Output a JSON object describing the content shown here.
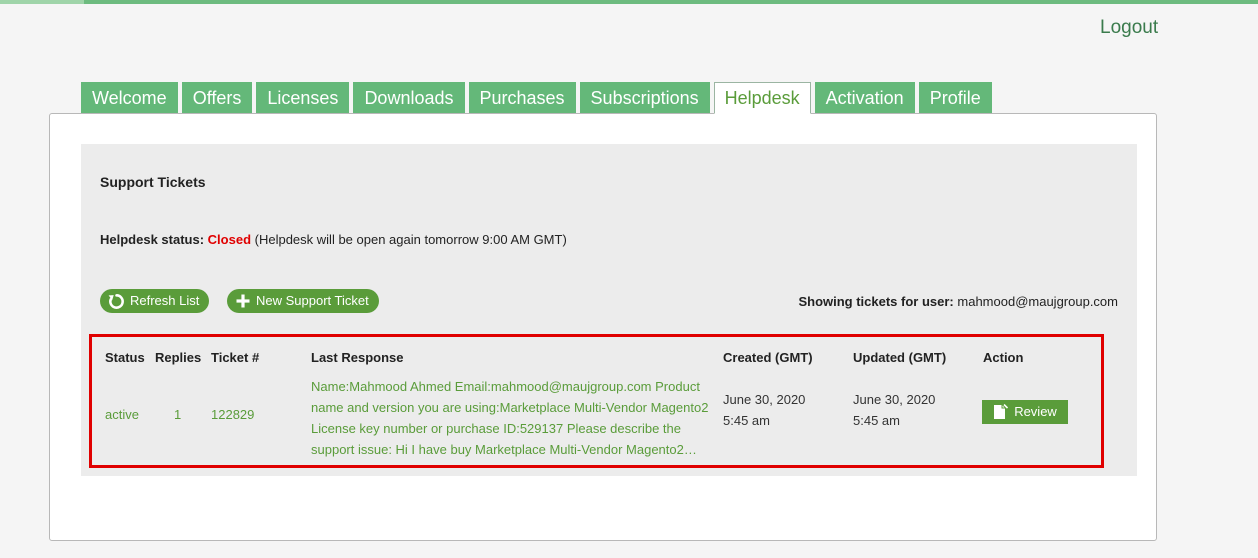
{
  "header": {
    "logout_label": "Logout"
  },
  "tabs": [
    {
      "label": "Welcome"
    },
    {
      "label": "Offers"
    },
    {
      "label": "Licenses"
    },
    {
      "label": "Downloads"
    },
    {
      "label": "Purchases"
    },
    {
      "label": "Subscriptions"
    },
    {
      "label": "Helpdesk",
      "active": true
    },
    {
      "label": "Activation"
    },
    {
      "label": "Profile"
    }
  ],
  "helpdesk": {
    "title": "Support Tickets",
    "status_label": "Helpdesk status:",
    "status_value": "Closed",
    "status_note": "(Helpdesk will be open again tomorrow 9:00 AM GMT)",
    "refresh_label": "Refresh List",
    "new_ticket_label": "New Support Ticket",
    "showing_label": "Showing tickets for user:",
    "showing_user": "mahmood@maujgroup.com",
    "table": {
      "headers": [
        "Status",
        "Replies",
        "Ticket #",
        "Last Response",
        "Created (GMT)",
        "Updated (GMT)",
        "Action"
      ],
      "rows": [
        {
          "status": "active",
          "replies": "1",
          "ticket": "122829",
          "last_response": "Name:Mahmood Ahmed Email:mahmood@maujgroup.com Product name and version you are using:Marketplace Multi-Vendor Magento2 License key number or purchase ID:529137 Please describe the support issue: Hi I have buy Marketplace Multi-Vendor Magento2…",
          "created_date": "June 30, 2020",
          "created_time": "5:45 am",
          "updated_date": "June 30, 2020",
          "updated_time": "5:45 am",
          "action_label": "Review"
        }
      ]
    }
  },
  "colors": {
    "brand_green": "#64b879",
    "action_green": "#5a9c3a",
    "closed_red": "#e00000",
    "highlight_border": "#e00000"
  },
  "icons": {
    "refresh": "refresh-icon",
    "new_ticket": "plus-icon",
    "review": "document-edit-icon"
  }
}
